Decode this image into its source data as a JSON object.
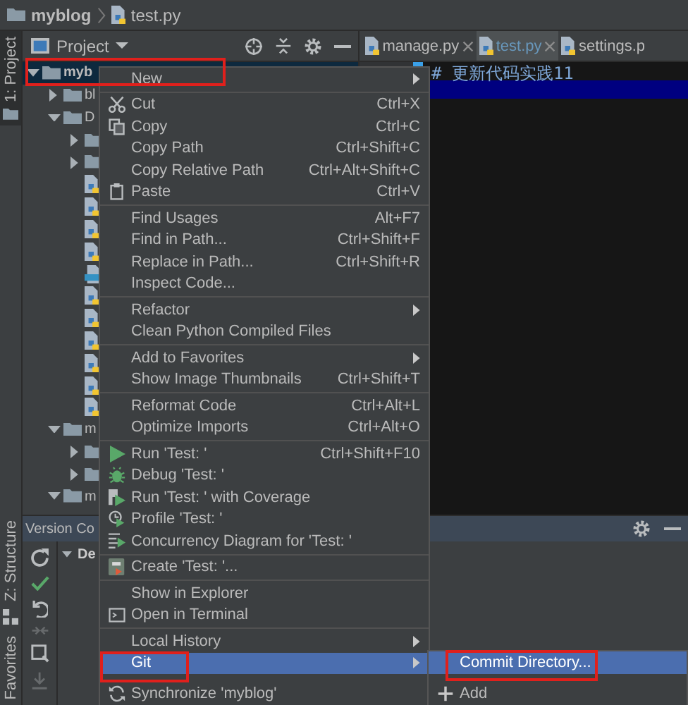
{
  "breadcrumb": [
    {
      "kind": "folder",
      "label": "myblog"
    },
    {
      "kind": "python_file",
      "label": "test.py"
    }
  ],
  "side_tabs": [
    {
      "label": "1: Project",
      "selected": true
    },
    {
      "label": "Z: Structure",
      "selected": false
    },
    {
      "label": "Favorites",
      "selected": false
    }
  ],
  "project_panel": {
    "title": "Project",
    "actions": [
      {
        "kind": "locate"
      },
      {
        "kind": "collapse"
      },
      {
        "kind": "gear"
      },
      {
        "kind": "minus"
      }
    ],
    "tree": [
      {
        "kind": "folder",
        "label": "myb",
        "expanded": true,
        "selected": true,
        "annotated": true,
        "children": [
          {
            "kind": "folder",
            "label": "bl",
            "expanded": false,
            "selected": false,
            "annotated": false
          },
          {
            "kind": "folder",
            "label": "D",
            "expanded": true,
            "selected": false,
            "annotated": false,
            "children": [
              {
                "kind": "folder",
                "expanded": false,
                "selected": false,
                "annotated": false
              },
              {
                "kind": "folder",
                "expanded": false,
                "selected": false,
                "annotated": false
              },
              {
                "kind": "python_file",
                "selected": false,
                "annotated": false
              },
              {
                "kind": "python_file",
                "selected": false,
                "annotated": false
              },
              {
                "kind": "python_file",
                "selected": false,
                "annotated": false
              },
              {
                "kind": "python_file",
                "selected": false,
                "annotated": false
              },
              {
                "kind": "html_file",
                "selected": false,
                "annotated": false
              },
              {
                "kind": "python_file",
                "selected": false,
                "annotated": false
              },
              {
                "kind": "python_file",
                "selected": false,
                "annotated": false
              },
              {
                "kind": "python_file",
                "selected": false,
                "annotated": false
              },
              {
                "kind": "python_file",
                "selected": false,
                "annotated": false
              },
              {
                "kind": "python_file",
                "selected": false,
                "annotated": false
              },
              {
                "kind": "python_file",
                "selected": false,
                "annotated": false
              }
            ]
          },
          {
            "kind": "folder",
            "label": "m",
            "expanded": true,
            "selected": false,
            "annotated": false,
            "children": [
              {
                "kind": "folder",
                "expanded": false,
                "selected": false,
                "annotated": false
              },
              {
                "kind": "folder",
                "expanded": false,
                "selected": false,
                "annotated": false
              }
            ]
          },
          {
            "kind": "folder",
            "label": "m",
            "expanded": true,
            "selected": false,
            "annotated": false
          }
        ]
      }
    ]
  },
  "editor": {
    "tabs": [
      {
        "label": "manage.py",
        "selected": false,
        "modified": false,
        "closable": true
      },
      {
        "label": "test.py",
        "selected": true,
        "modified": true,
        "closable": true
      },
      {
        "label": "settings.p",
        "selected": false,
        "modified": false,
        "closable": false
      }
    ],
    "lines": [
      {
        "text": "# 更新代码实践11",
        "current": false
      },
      {
        "current": true
      }
    ]
  },
  "version_control": {
    "title": "Version Co",
    "actions": [
      {
        "kind": "gear"
      },
      {
        "kind": "minus"
      }
    ],
    "toolbar": [
      {
        "kind": "refresh",
        "disabled": false
      },
      {
        "kind": "check",
        "disabled": false
      },
      {
        "kind": "undo",
        "disabled": false
      },
      {
        "kind": "arrows",
        "disabled": true
      },
      {
        "kind": "diff",
        "disabled": false
      },
      {
        "kind": "download",
        "disabled": true
      }
    ],
    "tree": [
      {
        "label": "De",
        "expanded": true
      }
    ]
  },
  "context_menu": {
    "items": [
      {
        "kind": "item",
        "label": "New",
        "submenu": true,
        "selected": false,
        "annotated": false
      },
      {
        "kind": "separator"
      },
      {
        "kind": "item",
        "label": "Cut",
        "shortcut": "Ctrl+X",
        "submenu": false,
        "selected": false,
        "annotated": false
      },
      {
        "kind": "item",
        "label": "Copy",
        "shortcut": "Ctrl+C",
        "submenu": false,
        "selected": false,
        "annotated": false
      },
      {
        "kind": "item",
        "label": "Copy Path",
        "shortcut": "Ctrl+Shift+C",
        "submenu": false,
        "selected": false,
        "annotated": false
      },
      {
        "kind": "item",
        "label": "Copy Relative Path",
        "shortcut": "Ctrl+Alt+Shift+C",
        "submenu": false,
        "selected": false,
        "annotated": false
      },
      {
        "kind": "item",
        "label": "Paste",
        "shortcut": "Ctrl+V",
        "submenu": false,
        "selected": false,
        "annotated": false
      },
      {
        "kind": "separator"
      },
      {
        "kind": "item",
        "label": "Find Usages",
        "shortcut": "Alt+F7",
        "submenu": false,
        "selected": false,
        "annotated": false
      },
      {
        "kind": "item",
        "label": "Find in Path...",
        "shortcut": "Ctrl+Shift+F",
        "submenu": false,
        "selected": false,
        "annotated": false
      },
      {
        "kind": "item",
        "label": "Replace in Path...",
        "shortcut": "Ctrl+Shift+R",
        "submenu": false,
        "selected": false,
        "annotated": false
      },
      {
        "kind": "item",
        "label": "Inspect Code...",
        "submenu": false,
        "selected": false,
        "annotated": false
      },
      {
        "kind": "separator"
      },
      {
        "kind": "item",
        "label": "Refactor",
        "submenu": true,
        "selected": false,
        "annotated": false
      },
      {
        "kind": "item",
        "label": "Clean Python Compiled Files",
        "submenu": false,
        "selected": false,
        "annotated": false
      },
      {
        "kind": "separator"
      },
      {
        "kind": "item",
        "label": "Add to Favorites",
        "submenu": true,
        "selected": false,
        "annotated": false
      },
      {
        "kind": "item",
        "label": "Show Image Thumbnails",
        "shortcut": "Ctrl+Shift+T",
        "submenu": false,
        "selected": false,
        "annotated": false
      },
      {
        "kind": "separator"
      },
      {
        "kind": "item",
        "label": "Reformat Code",
        "shortcut": "Ctrl+Alt+L",
        "submenu": false,
        "selected": false,
        "annotated": false
      },
      {
        "kind": "item",
        "label": "Optimize Imports",
        "shortcut": "Ctrl+Alt+O",
        "submenu": false,
        "selected": false,
        "annotated": false
      },
      {
        "kind": "separator"
      },
      {
        "kind": "item",
        "label": "Run 'Test: '",
        "shortcut": "Ctrl+Shift+F10",
        "submenu": false,
        "selected": false,
        "annotated": false
      },
      {
        "kind": "item",
        "label": "Debug 'Test: '",
        "submenu": false,
        "selected": false,
        "annotated": false
      },
      {
        "kind": "item",
        "label": "Run 'Test: ' with Coverage",
        "submenu": false,
        "selected": false,
        "annotated": false
      },
      {
        "kind": "item",
        "label": "Profile 'Test: '",
        "submenu": false,
        "selected": false,
        "annotated": false
      },
      {
        "kind": "item",
        "label": "Concurrency Diagram for 'Test: '",
        "submenu": false,
        "selected": false,
        "annotated": false
      },
      {
        "kind": "separator"
      },
      {
        "kind": "item",
        "label": "Create 'Test: '...",
        "submenu": false,
        "selected": false,
        "annotated": false
      },
      {
        "kind": "separator"
      },
      {
        "kind": "item",
        "label": "Show in Explorer",
        "submenu": false,
        "selected": false,
        "annotated": false
      },
      {
        "kind": "item",
        "label": "Open in Terminal",
        "submenu": false,
        "selected": false,
        "annotated": false
      },
      {
        "kind": "separator"
      },
      {
        "kind": "item",
        "label": "Local History",
        "submenu": true,
        "selected": false,
        "annotated": false
      },
      {
        "kind": "item",
        "label": "Git",
        "submenu": true,
        "selected": true,
        "annotated": true
      },
      {
        "kind": "item",
        "label": "Synchronize 'myblog'",
        "submenu": false,
        "selected": false,
        "annotated": false
      }
    ]
  },
  "git_submenu": {
    "items": [
      {
        "kind": "item",
        "label": "Commit Directory...",
        "submenu": false,
        "selected": true,
        "annotated": true
      },
      {
        "kind": "item",
        "label": "Add",
        "submenu": false,
        "selected": false,
        "annotated": false
      }
    ]
  }
}
